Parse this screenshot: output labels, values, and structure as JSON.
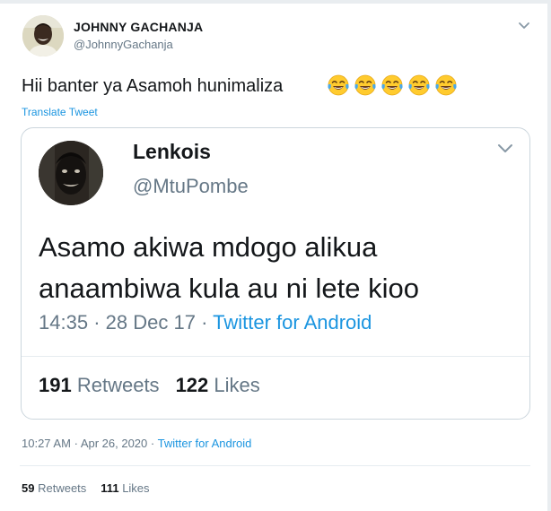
{
  "tweet": {
    "author_name": "JOHNNY GACHANJA",
    "author_handle": "@JohnnyGachanja",
    "text": "Hii banter ya Asamoh hunimaliza",
    "emoji_icons": [
      "joy-emoji-icon",
      "joy-emoji-icon",
      "joy-emoji-icon",
      "joy-emoji-icon",
      "joy-emoji-icon"
    ],
    "translate_label": "Translate Tweet",
    "time": "10:27 AM",
    "date": "Apr 26, 2020",
    "separator": "·",
    "source": "Twitter for Android",
    "retweets_count": "59",
    "retweets_label": "Retweets",
    "likes_count": "111",
    "likes_label": "Likes"
  },
  "quoted_tweet": {
    "author_name": "Lenkois",
    "author_handle": "@MtuPombe",
    "text_line1": "Asamo akiwa mdogo alikua",
    "text_line2": "anaambiwa kula au ni lete kioo",
    "time": "14:35",
    "date": "28 Dec 17",
    "separator": "·",
    "source": "Twitter for Android",
    "retweets_count": "191",
    "retweets_label": "Retweets",
    "likes_count": "122",
    "likes_label": "Likes"
  },
  "colors": {
    "link": "#1b95e0",
    "muted": "#657786",
    "text": "#14171a",
    "border": "#ccd6dd"
  }
}
